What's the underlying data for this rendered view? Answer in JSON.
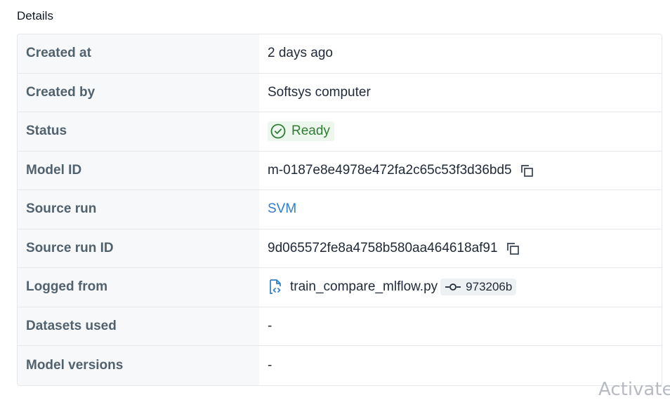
{
  "section": {
    "title": "Details"
  },
  "rows": {
    "created_at": {
      "label": "Created at",
      "value": "2 days ago"
    },
    "created_by": {
      "label": "Created by",
      "value": "Softsys computer"
    },
    "status": {
      "label": "Status",
      "value": "Ready",
      "color": "#2e7d32",
      "icon": "check-circle-icon"
    },
    "model_id": {
      "label": "Model ID",
      "value": "m-0187e8e4978e472fa2c65c53f3d36bd5",
      "icon": "copy-icon"
    },
    "source_run": {
      "label": "Source run",
      "value": "SVM",
      "color": "#2f7ecb"
    },
    "source_run_id": {
      "label": "Source run ID",
      "value": "9d065572fe8a4758b580aa464618af91",
      "icon": "copy-icon"
    },
    "logged_from": {
      "label": "Logged from",
      "file": "train_compare_mlflow.py",
      "commit": "973206b",
      "file_icon": "code-file-icon",
      "commit_icon": "git-commit-icon"
    },
    "datasets_used": {
      "label": "Datasets used",
      "value": "-"
    },
    "model_versions": {
      "label": "Model versions",
      "value": "-"
    }
  },
  "watermark": {
    "text": "Activate"
  }
}
